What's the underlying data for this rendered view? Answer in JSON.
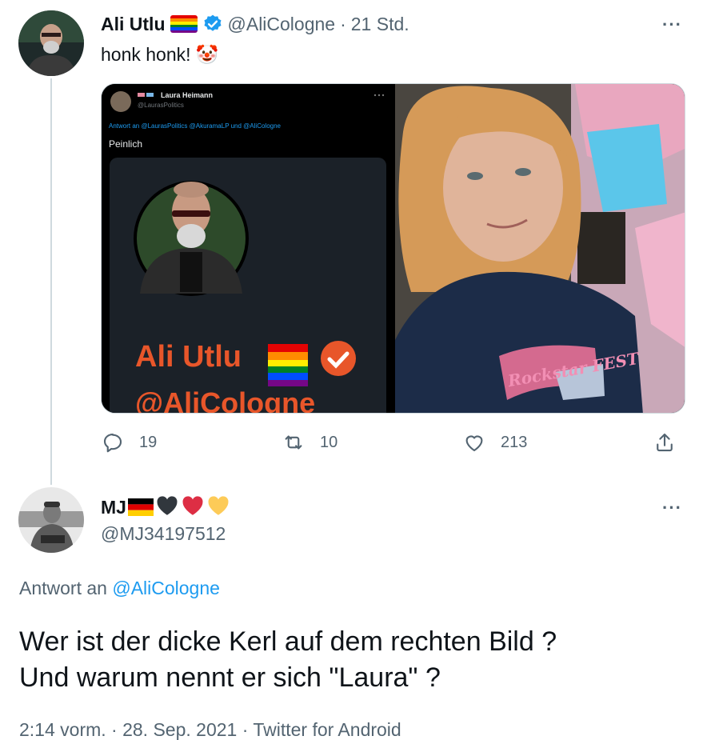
{
  "tweet1": {
    "author_name": "Ali Utlu",
    "handle": "@AliCologne",
    "separator": "·",
    "time": "21 Std.",
    "text": "honk honk! 🤡",
    "more_label": "···",
    "media_left": {
      "inner_name": "Laura Heimann",
      "inner_handle": "@LaurasPolitics",
      "reply_to": "Antwort an @LaurasPolitics @AkuramaLP und @AliCologne",
      "inner_text": "Peinlich",
      "profile_name": "Ali Utlu",
      "profile_handle": "@AliCologne"
    },
    "media_right": {
      "shirt_text": "Rockstar FEST"
    },
    "replies": "19",
    "retweets": "10",
    "likes": "213"
  },
  "tweet2": {
    "author_name": "MJ",
    "author_emojis": "🖤❤️💛",
    "handle": "@MJ34197512",
    "more_label": "···",
    "reply_prefix": "Antwort an",
    "reply_handle": "@AliCologne",
    "text_line1": "Wer ist der dicke Kerl auf dem rechten Bild ?",
    "text_line2": "Und warum nennt er sich \"Laura\" ?",
    "meta": "2:14 vorm. · 28. Sep. 2021 · Twitter for Android"
  },
  "colors": {
    "link": "#1d9bf0",
    "secondary_text": "#536471",
    "verified": "#1d9bf0",
    "inner_orange": "#e8562a"
  }
}
